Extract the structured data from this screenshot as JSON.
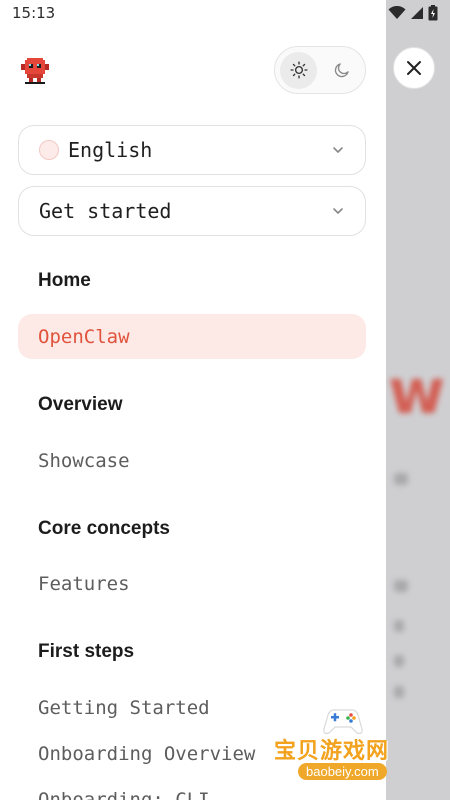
{
  "status_bar": {
    "time": "15:13",
    "icons": [
      "wifi-icon",
      "signal-icon",
      "battery-icon"
    ]
  },
  "backdrop": {
    "ghost_text": "w"
  },
  "drawer": {
    "logo_icon": "lobster-logo-icon",
    "theme_toggle": {
      "options": [
        "sun-icon",
        "moon-icon"
      ],
      "active": "light"
    },
    "language_select": {
      "value": "English"
    },
    "section_select": {
      "value": "Get started"
    },
    "nav": {
      "home_heading": "Home",
      "active_item": "OpenClaw",
      "overview_heading": "Overview",
      "showcase": "Showcase",
      "core_concepts_heading": "Core concepts",
      "features": "Features",
      "first_steps_heading": "First steps",
      "getting_started": "Getting Started",
      "onboarding_overview": "Onboarding Overview",
      "onboarding_cli": "Onboarding: CLI"
    }
  },
  "close_button": {
    "icon": "close-icon"
  },
  "watermark": {
    "text": "宝贝游戏网",
    "url": "baobeiy.com"
  },
  "colors": {
    "accent": "#e0533d",
    "active_bg": "#fde9e6",
    "backdrop": "#cfcfd2"
  }
}
